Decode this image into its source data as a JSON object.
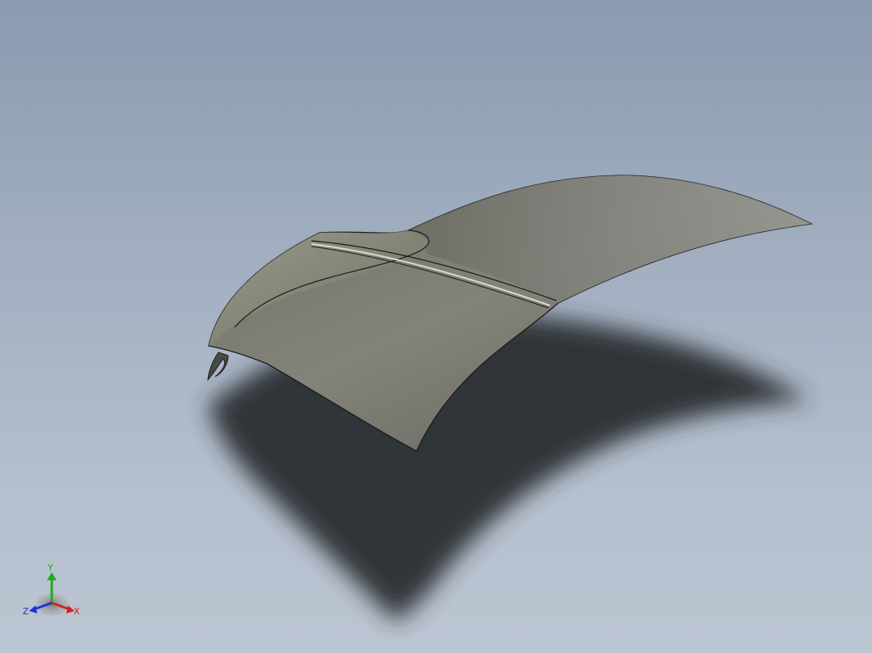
{
  "viewport": {
    "background_top": "#8a9ab0",
    "background_bottom": "#bcc5d2",
    "part_color": "#7f7f74",
    "shadow_color": "#2a2d33"
  },
  "triad": {
    "x_label": "X",
    "y_label": "Y",
    "z_label": "Z",
    "x_color": "#d42020",
    "y_color": "#1faa1f",
    "z_color": "#2030d8"
  }
}
